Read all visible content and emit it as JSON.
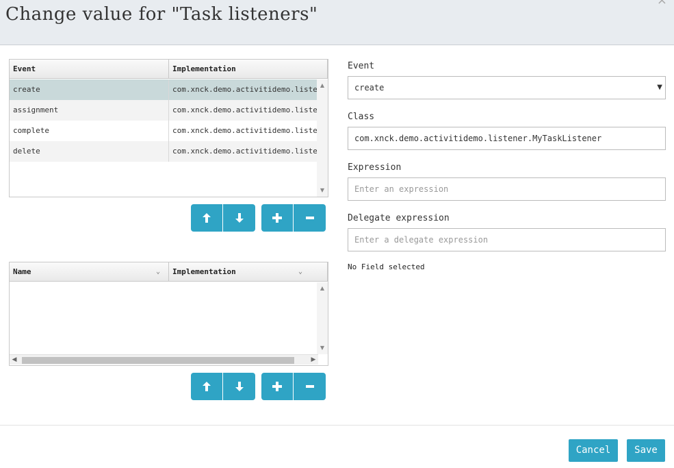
{
  "dialog": {
    "title": "Change value for \"Task listeners\"",
    "close_glyph": "×"
  },
  "listeners_grid": {
    "columns": [
      "Event",
      "Implementation"
    ],
    "rows": [
      {
        "event": "create",
        "implementation": "com.xnck.demo.activitidemo.listene··",
        "selected": true
      },
      {
        "event": "assignment",
        "implementation": "com.xnck.demo.activitidemo.listene··",
        "selected": false
      },
      {
        "event": "complete",
        "implementation": "com.xnck.demo.activitidemo.listene··",
        "selected": false
      },
      {
        "event": "delete",
        "implementation": "com.xnck.demo.activitidemo.listene··",
        "selected": false
      }
    ]
  },
  "fields_grid": {
    "columns": [
      "Name",
      "Implementation"
    ],
    "rows": []
  },
  "buttons": {
    "move_up_icon": "arrow-up-icon",
    "move_down_icon": "arrow-down-icon",
    "add_icon": "plus-icon",
    "remove_icon": "minus-icon",
    "cancel": "Cancel",
    "save": "Save"
  },
  "form": {
    "event_label": "Event",
    "event_value": "create",
    "class_label": "Class",
    "class_value": "com.xnck.demo.activitidemo.listener.MyTaskListener",
    "expression_label": "Expression",
    "expression_placeholder": "Enter an expression",
    "delegate_label": "Delegate expression",
    "delegate_placeholder": "Enter a delegate expression",
    "no_field_text": "No Field selected"
  },
  "colors": {
    "accent": "#2fa4c5",
    "selected_row": "#c9d9da",
    "header_bg": "#e8ecf0"
  }
}
